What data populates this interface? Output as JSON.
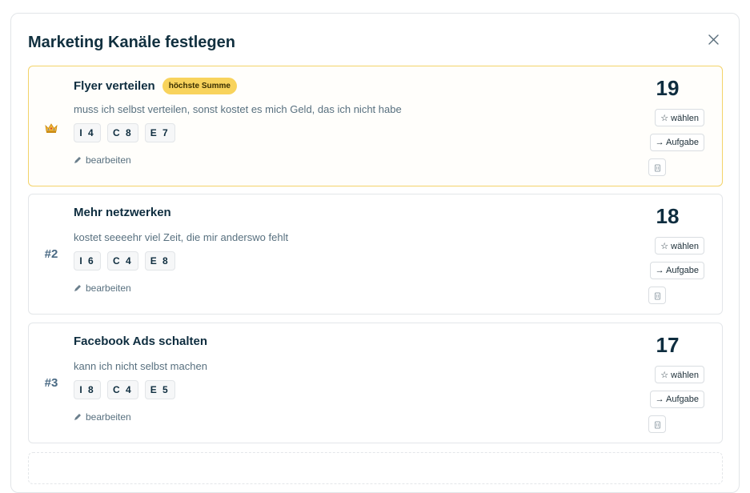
{
  "modal": {
    "title": "Marketing Kanäle festlegen",
    "close_icon": "close-icon"
  },
  "colors": {
    "highlight_border": "#f3d36a",
    "badge_bg": "#f8d35c",
    "text_primary": "#0e2d3f"
  },
  "cards": [
    {
      "rank": "",
      "rank_icon": "crown-icon",
      "title": "Flyer verteilen",
      "badge": "höchste Summe",
      "description": "muss ich selbst verteilen, sonst kostet es mich Geld, das ich nicht habe",
      "chips": [
        "I 4",
        "C 8",
        "E 7"
      ],
      "edit_label": "bearbeiten",
      "score": "19",
      "select_label": "☆ wählen",
      "task_label": "→ Aufgabe"
    },
    {
      "rank": "#2",
      "title": "Mehr netzwerken",
      "description": "kostet seeeehr viel Zeit, die mir anderswo fehlt",
      "chips": [
        "I 6",
        "C 4",
        "E 8"
      ],
      "edit_label": "bearbeiten",
      "score": "18",
      "select_label": "☆ wählen",
      "task_label": "→ Aufgabe"
    },
    {
      "rank": "#3",
      "title": "Facebook Ads schalten",
      "description": "kann ich nicht selbst machen",
      "chips": [
        "I 8",
        "C 4",
        "E 5"
      ],
      "edit_label": "bearbeiten",
      "score": "17",
      "select_label": "☆ wählen",
      "task_label": "→ Aufgabe"
    }
  ]
}
